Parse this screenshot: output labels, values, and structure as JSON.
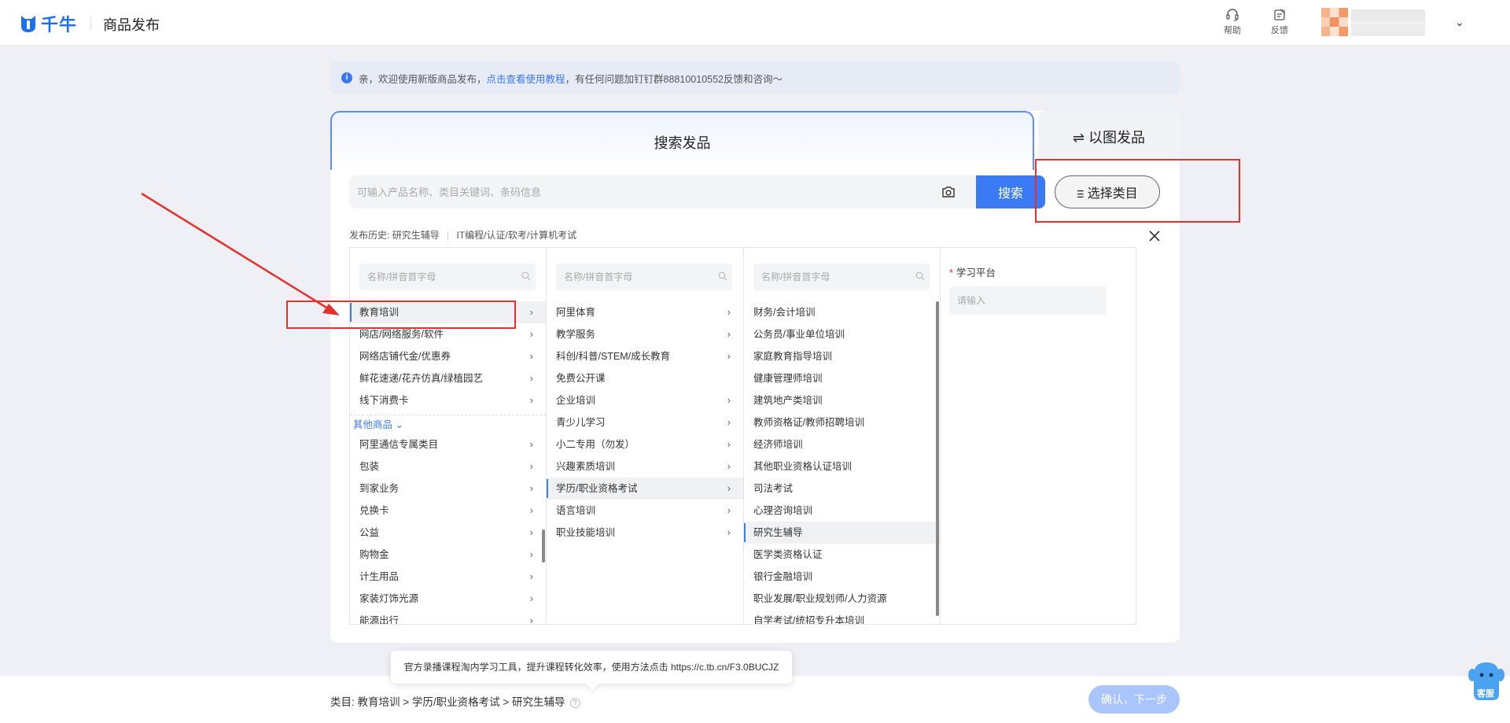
{
  "header": {
    "logo_text": "千牛",
    "title": "商品发布",
    "help_label": "帮助",
    "feedback_label": "反馈"
  },
  "notice": {
    "prefix": "亲，欢迎使用新版商品发布，",
    "link": "点击查看使用教程",
    "suffix": "，有任何问题加钉钉群88810010552反馈和咨询～"
  },
  "tabs": {
    "search": "搜索发品",
    "image": "⇌ 以图发品"
  },
  "search": {
    "placeholder": "可输入产品名称、类目关键词、条码信息",
    "button": "搜索",
    "select_category": "ⲷ 选择类目"
  },
  "history": {
    "label": "发布历史:",
    "items": [
      "研究生辅导",
      "IT编程/认证/软考/计算机考试"
    ]
  },
  "columns": {
    "search_placeholder": "名称/拼音首字母",
    "col1": [
      {
        "label": "教育培训",
        "arrow": true,
        "selected": true
      },
      {
        "label": "网店/网络服务/软件",
        "arrow": true
      },
      {
        "label": "网络店铺代金/优惠券",
        "arrow": true
      },
      {
        "label": "鲜花速递/花卉仿真/绿植园艺",
        "arrow": true
      },
      {
        "label": "线下消费卡",
        "arrow": true
      }
    ],
    "other_header": "其他商品 ⌄",
    "col1_other": [
      {
        "label": "阿里通信专属类目",
        "arrow": true
      },
      {
        "label": "包装",
        "arrow": true
      },
      {
        "label": "到家业务",
        "arrow": true
      },
      {
        "label": "兑换卡",
        "arrow": true
      },
      {
        "label": "公益",
        "arrow": true
      },
      {
        "label": "购物金",
        "arrow": true
      },
      {
        "label": "计生用品",
        "arrow": true
      },
      {
        "label": "家装灯饰光源",
        "arrow": true
      },
      {
        "label": "能源出行",
        "arrow": true
      }
    ],
    "col2": [
      {
        "label": "阿里体育",
        "arrow": true
      },
      {
        "label": "教学服务",
        "arrow": true
      },
      {
        "label": "科创/科普/STEM/成长教育",
        "arrow": true
      },
      {
        "label": "免费公开课",
        "arrow": false
      },
      {
        "label": "企业培训",
        "arrow": true
      },
      {
        "label": "青少儿学习",
        "arrow": true
      },
      {
        "label": "小二专用（勿发）",
        "arrow": true
      },
      {
        "label": "兴趣素质培训",
        "arrow": true
      },
      {
        "label": "学历/职业资格考试",
        "arrow": true,
        "selected": true
      },
      {
        "label": "语言培训",
        "arrow": true
      },
      {
        "label": "职业技能培训",
        "arrow": true
      }
    ],
    "col3": [
      {
        "label": "财务/会计培训",
        "arrow": false
      },
      {
        "label": "公务员/事业单位培训",
        "arrow": false
      },
      {
        "label": "家庭教育指导培训",
        "arrow": false
      },
      {
        "label": "健康管理师培训",
        "arrow": false
      },
      {
        "label": "建筑地产类培训",
        "arrow": false
      },
      {
        "label": "教师资格证/教师招聘培训",
        "arrow": false
      },
      {
        "label": "经济师培训",
        "arrow": false
      },
      {
        "label": "其他职业资格认证培训",
        "arrow": false
      },
      {
        "label": "司法考试",
        "arrow": false
      },
      {
        "label": "心理咨询培训",
        "arrow": false
      },
      {
        "label": "研究生辅导",
        "arrow": false,
        "selected": true
      },
      {
        "label": "医学类资格认证",
        "arrow": false
      },
      {
        "label": "银行金融培训",
        "arrow": false
      },
      {
        "label": "职业发展/职业规划师/人力资源",
        "arrow": false
      },
      {
        "label": "自学考试/统招专升本培训",
        "arrow": false
      }
    ]
  },
  "attribute": {
    "label": "学习平台",
    "placeholder": "请输入"
  },
  "tooltip": "官方录播课程淘内学习工具，提升课程转化效率，使用方法点击 https://c.tb.cn/F3.0BUCJZ",
  "footer": {
    "breadcrumb": "类目:  教育培训 > 学历/职业资格考试 > 研究生辅导",
    "confirm": "确认，下一步",
    "service": "客服"
  },
  "colors": {
    "accent": "#3a7bf5",
    "annotation_red": "#e8302a"
  }
}
